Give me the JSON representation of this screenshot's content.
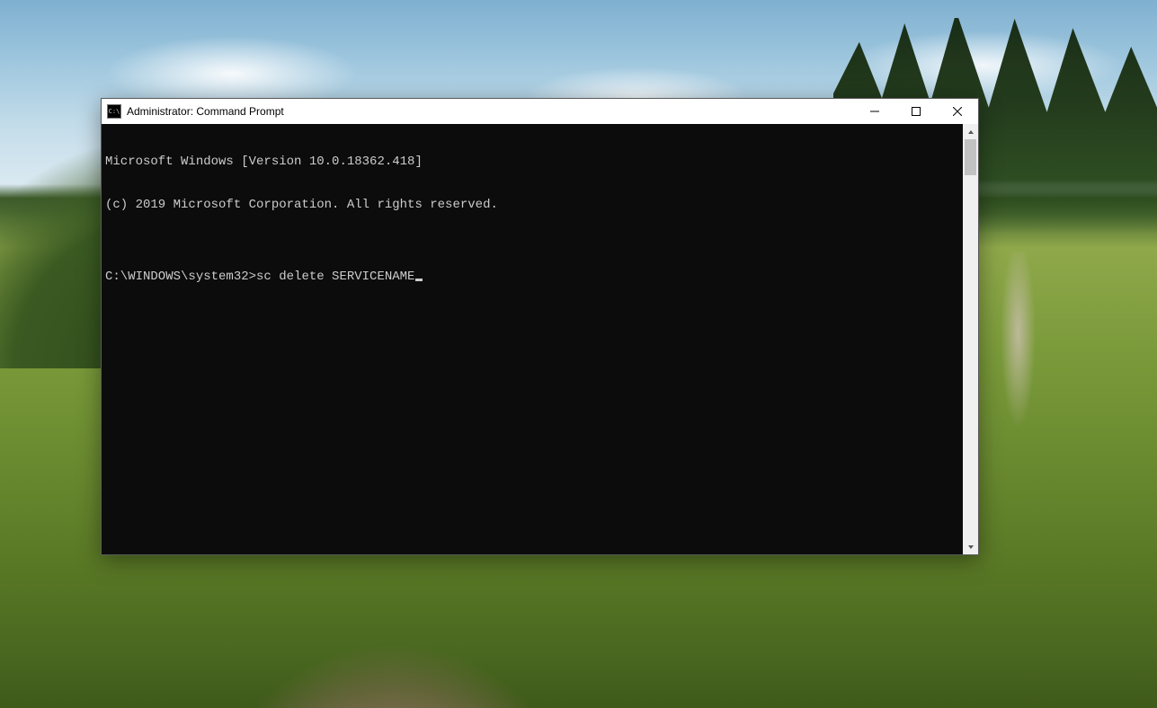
{
  "window": {
    "title": "Administrator: Command Prompt",
    "icon_name": "cmd-icon"
  },
  "terminal": {
    "line1": "Microsoft Windows [Version 10.0.18362.418]",
    "line2": "(c) 2019 Microsoft Corporation. All rights reserved.",
    "blank": "",
    "prompt": "C:\\WINDOWS\\system32>",
    "command": "sc delete SERVICENAME"
  }
}
